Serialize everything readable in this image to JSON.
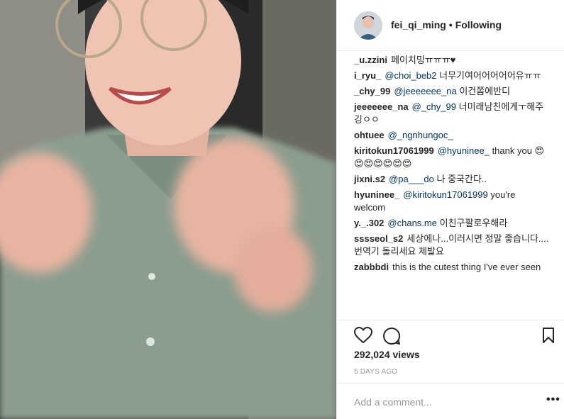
{
  "header": {
    "username": "fei_qi_ming",
    "separator": "•",
    "follow_status": "Following"
  },
  "comments": [
    {
      "user": "_u.zzini",
      "mention": "",
      "text": "페이치밍ㅠㅠㅠ♥"
    },
    {
      "user": "i_ryu_",
      "mention": "@choi_beb2",
      "text": "너무기여어어어어어유ㅠㅠ"
    },
    {
      "user": "_chy_99",
      "mention": "@jeeeeeee_na",
      "text": "이건쫌에반디"
    },
    {
      "user": "jeeeeeee_na",
      "mention": "@_chy_99",
      "text": "너미래남친에게ㅜ해주깅ㅇㅇ"
    },
    {
      "user": "ohtuee",
      "mention": "@_ngnhungoc_",
      "text": ""
    },
    {
      "user": "kiritokun17061999",
      "mention": "@hyuninee_",
      "text": "thank you 😍😍😍😍😍😍😍"
    },
    {
      "user": "jixni.s2",
      "mention": "@pa___do",
      "text": "나 중국간다.."
    },
    {
      "user": "hyuninee_",
      "mention": "@kiritokun17061999",
      "text": "you're welcom"
    },
    {
      "user": "y._.302",
      "mention": "@chans.me",
      "text": "이친구팔로우해라"
    },
    {
      "user": "sssseol_s2",
      "mention": "",
      "text": "세상에나...이러시면 정말 좋습니다....번역기 돌리세요 제발요"
    },
    {
      "user": "zabbbdi",
      "mention": "",
      "text": "this is the cutest thing I've ever seen"
    }
  ],
  "stats": {
    "views": "292,024 views",
    "time_ago": "5 DAYS AGO"
  },
  "compose": {
    "placeholder": "Add a comment...",
    "more_label": "•••"
  },
  "icons": {
    "like": "heart-icon",
    "comment": "comment-bubble-icon",
    "save": "bookmark-icon",
    "more": "more-options-icon"
  },
  "colors": {
    "text": "#262626",
    "mention": "#003569",
    "muted": "#999999",
    "divider": "#efefef"
  }
}
